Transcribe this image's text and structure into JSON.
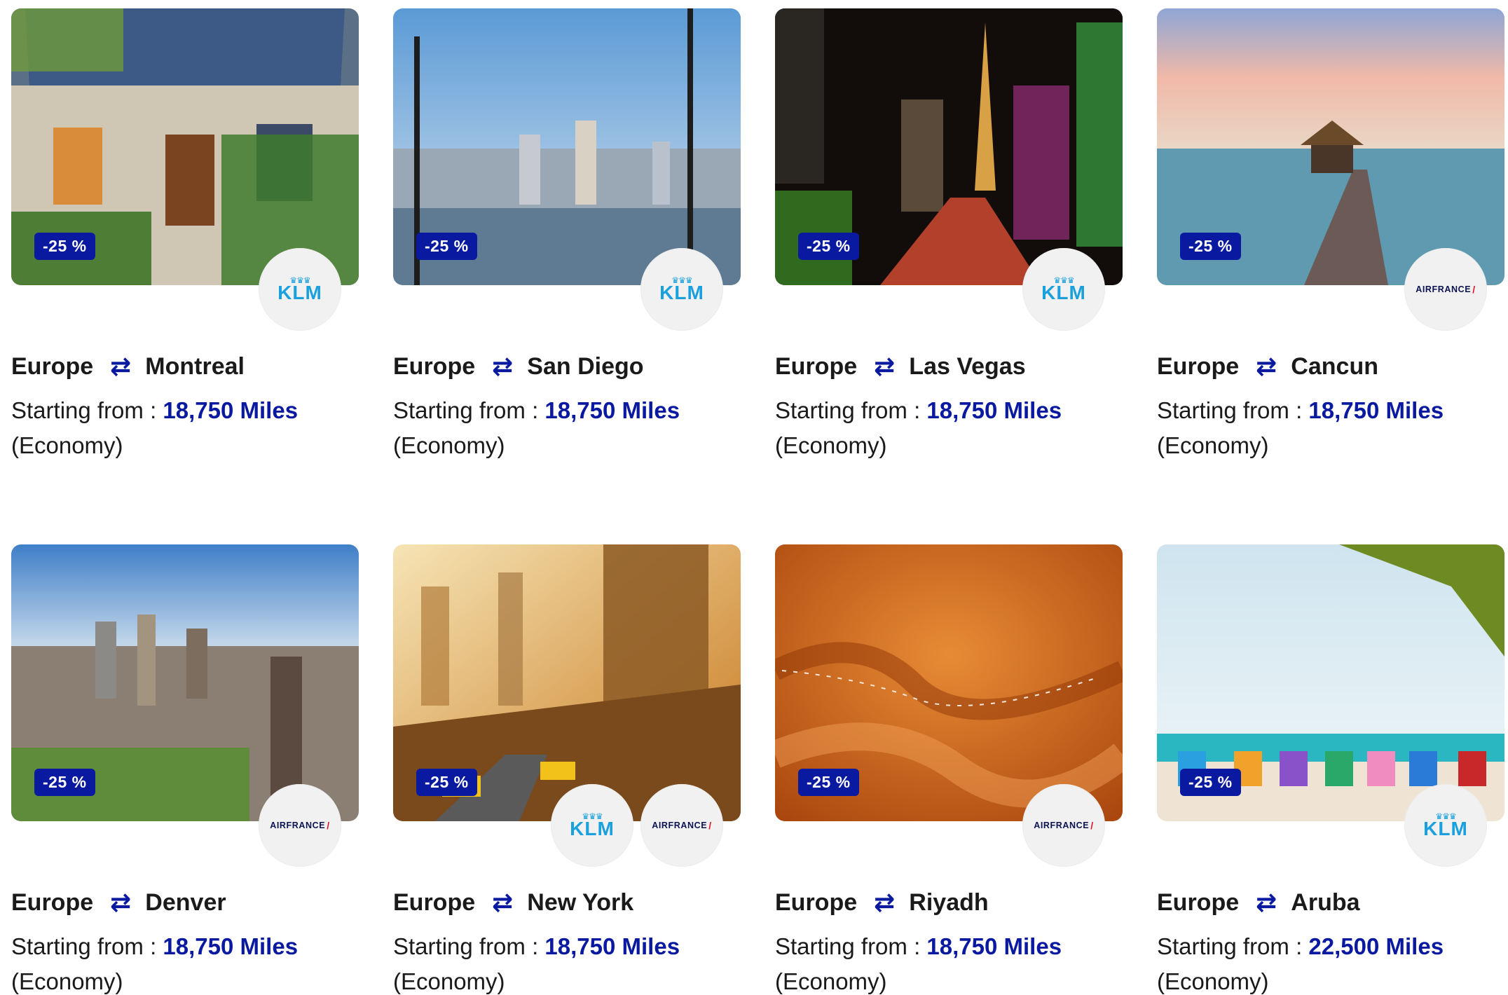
{
  "colors": {
    "accent": "#0a1aa0",
    "klm_blue": "#1aa0dd",
    "airfrance_red": "#e0142b"
  },
  "common": {
    "origin": "Europe",
    "starting_from_label": "Starting from : ",
    "cabin": "(Economy)",
    "arrow_icon": "round-trip-arrows-icon"
  },
  "offers": [
    {
      "destination": "Montreal",
      "miles": "18,750 Miles",
      "discount": "-25 %",
      "airlines": [
        "KLM"
      ]
    },
    {
      "destination": "San Diego",
      "miles": "18,750 Miles",
      "discount": "-25 %",
      "airlines": [
        "KLM"
      ]
    },
    {
      "destination": "Las Vegas",
      "miles": "18,750 Miles",
      "discount": "-25 %",
      "airlines": [
        "KLM"
      ]
    },
    {
      "destination": "Cancun",
      "miles": "18,750 Miles",
      "discount": "-25 %",
      "airlines": [
        "AIRFRANCE"
      ]
    },
    {
      "destination": "Denver",
      "miles": "18,750 Miles",
      "discount": "-25 %",
      "airlines": [
        "AIRFRANCE"
      ]
    },
    {
      "destination": "New York",
      "miles": "18,750 Miles",
      "discount": "-25 %",
      "airlines": [
        "KLM",
        "AIRFRANCE"
      ]
    },
    {
      "destination": "Riyadh",
      "miles": "18,750 Miles",
      "discount": "-25 %",
      "airlines": [
        "AIRFRANCE"
      ]
    },
    {
      "destination": "Aruba",
      "miles": "22,500 Miles",
      "discount": "-25 %",
      "airlines": [
        "KLM"
      ]
    }
  ]
}
